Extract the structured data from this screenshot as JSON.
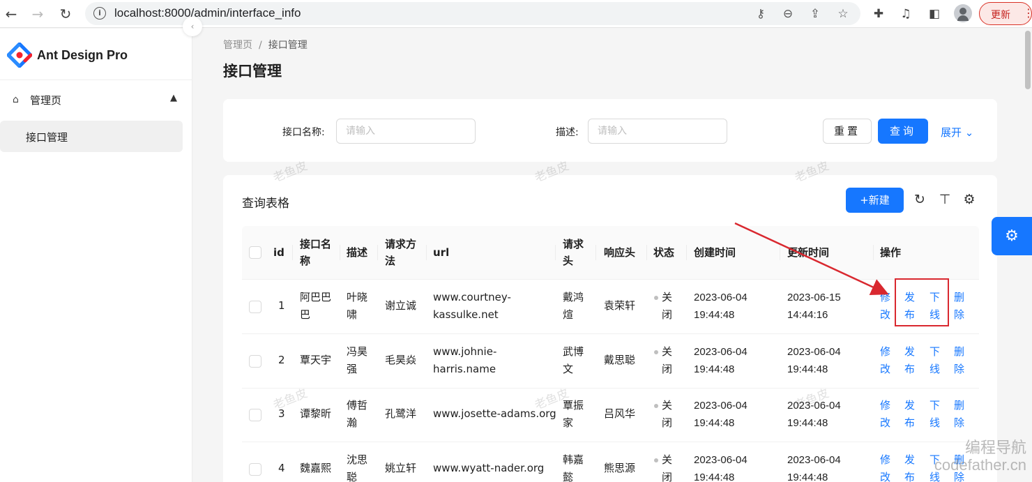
{
  "browser": {
    "url": "localhost:8000/admin/interface_info",
    "update_label": "更新"
  },
  "sidebar": {
    "brand": "Ant Design Pro",
    "menu_group": "管理页",
    "menu_item": "接口管理"
  },
  "header": {
    "breadcrumb": [
      "管理页",
      "接口管理"
    ],
    "title": "接口管理"
  },
  "search": {
    "name_label": "接口名称:",
    "name_placeholder": "请输入",
    "desc_label": "描述:",
    "desc_placeholder": "请输入",
    "reset_label": "重置",
    "query_label": "查询",
    "expand_label": "展开"
  },
  "table": {
    "title": "查询表格",
    "new_label": "+新建",
    "headers": {
      "id": "id",
      "name": [
        "接口名",
        "称"
      ],
      "desc": "描述",
      "method": [
        "请求方",
        "法"
      ],
      "url": "url",
      "req_header": [
        "请求",
        "头"
      ],
      "res_header": "响应头",
      "status": "状态",
      "created": "创建时间",
      "updated": "更新时间",
      "ops": "操作"
    },
    "rows": [
      {
        "id": "1",
        "name": [
          "阿巴巴",
          "巴"
        ],
        "desc": [
          "叶晓",
          "啸"
        ],
        "method": "谢立诚",
        "url": [
          "www.courtney-",
          "kassulke.net"
        ],
        "req_header": [
          "戴鸿",
          "煊"
        ],
        "res_header": "袁荣轩",
        "status": [
          "关",
          "闭"
        ],
        "created": [
          "2023-06-04",
          "19:44:48"
        ],
        "updated": [
          "2023-06-15",
          "14:44:16"
        ]
      },
      {
        "id": "2",
        "name": [
          "覃天宇"
        ],
        "desc": [
          "冯昊",
          "强"
        ],
        "method": "毛昊焱",
        "url": [
          "www.johnie-",
          "harris.name"
        ],
        "req_header": [
          "武博",
          "文"
        ],
        "res_header": "戴思聪",
        "status": [
          "关",
          "闭"
        ],
        "created": [
          "2023-06-04",
          "19:44:48"
        ],
        "updated": [
          "2023-06-04",
          "19:44:48"
        ]
      },
      {
        "id": "3",
        "name": [
          "谭黎昕"
        ],
        "desc": [
          "傅哲",
          "瀚"
        ],
        "method": "孔鹭洋",
        "url": [
          "www.josette-adams.org"
        ],
        "req_header": [
          "覃振",
          "家"
        ],
        "res_header": "吕风华",
        "status": [
          "关",
          "闭"
        ],
        "created": [
          "2023-06-04",
          "19:44:48"
        ],
        "updated": [
          "2023-06-04",
          "19:44:48"
        ]
      },
      {
        "id": "4",
        "name": [
          "魏嘉熙"
        ],
        "desc": [
          "沈思",
          "聪"
        ],
        "method": "姚立轩",
        "url": [
          "www.wyatt-nader.org"
        ],
        "req_header": [
          "韩嘉",
          "懿"
        ],
        "res_header": "熊思源",
        "status": [
          "关",
          "闭"
        ],
        "created": [
          "2023-06-04",
          "19:44:48"
        ],
        "updated": [
          "2023-06-04",
          "19:44:48"
        ]
      }
    ],
    "ops": [
      [
        "修",
        "改"
      ],
      [
        "发",
        "布"
      ],
      [
        "下",
        "线"
      ],
      [
        "删",
        "除"
      ]
    ]
  },
  "watermark": "老鱼皮",
  "corner_watermark": [
    "编程导航",
    "codefather.cn"
  ],
  "colors": {
    "primary": "#1677ff",
    "annotation": "#d9282f"
  },
  "icons": [
    "back-arrow-icon",
    "forward-arrow-icon",
    "reload-icon",
    "info-icon",
    "key-icon",
    "zoom-icon",
    "share-icon",
    "star-icon",
    "extension-icon",
    "playlist-icon",
    "sidepanel-icon",
    "profile-icon",
    "home-icon",
    "chevron-up-icon",
    "chevron-down-icon",
    "reload-table-icon",
    "density-icon",
    "settings-icon"
  ]
}
